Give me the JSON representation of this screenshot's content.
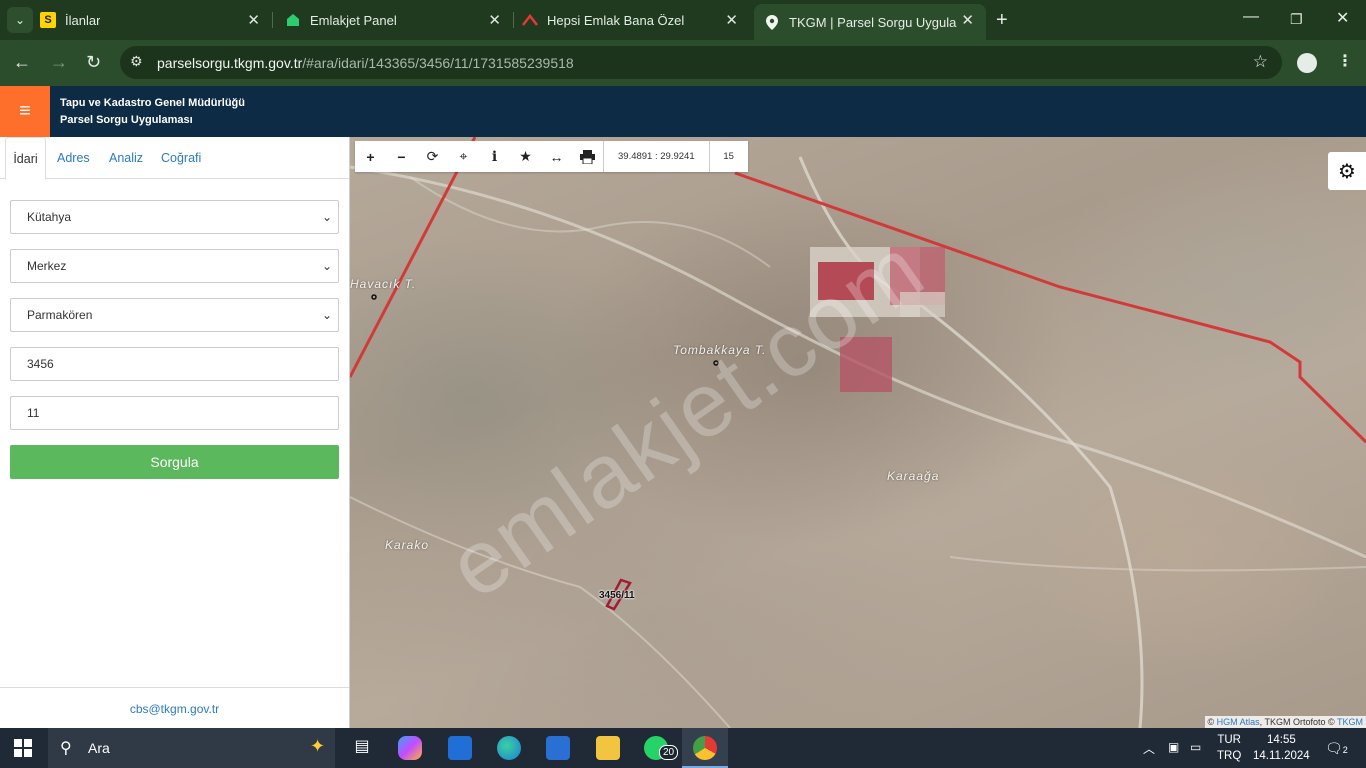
{
  "browser": {
    "tabs": [
      {
        "title": "İlanlar",
        "favicon": "S"
      },
      {
        "title": "Emlakjet Panel",
        "favicon": "house-icon"
      },
      {
        "title": "Hepsi Emlak Bana Özel",
        "favicon": "roof-icon"
      },
      {
        "title": "TKGM | Parsel Sorgu Uygulaması",
        "favicon": "pin-icon"
      }
    ],
    "url_host": "parselsorgu.tkgm.gov.tr",
    "url_path": "/#ara/idari/143365/3456/11/1731585239518"
  },
  "header": {
    "line1": "Tapu ve Kadastro Genel Müdürlüğü",
    "line2": "Parsel Sorgu Uygulaması",
    "accent": "#ff6f2c",
    "bg": "#0d2b45"
  },
  "sidebar": {
    "tabs": [
      "İdari",
      "Adres",
      "Analiz",
      "Coğrafi"
    ],
    "province": "Kütahya",
    "district": "Merkez",
    "neighborhood": "Parmakören",
    "block": "3456",
    "parcel": "11",
    "query_button": "Sorgula",
    "footer_email": "cbs@tkgm.gov.tr"
  },
  "map": {
    "coordinates": "39.4891 : 29.9241",
    "zoom": "15",
    "labels": [
      "Havacık T.",
      "Tombakkaya T.",
      "Karaağa",
      "Karako"
    ],
    "parcel_label": "3456/11",
    "watermark": "emlakjet.com",
    "attribution": {
      "prefix": "©",
      "hgm": "HGM Atlas",
      "middle": ", TKGM Ortofoto ©",
      "tkgm": "TKGM"
    }
  },
  "taskbar": {
    "search_placeholder": "Ara",
    "whatsapp_badge": "20",
    "lang_top": "TUR",
    "lang_bottom": "TRQ",
    "time": "14:55",
    "date": "14.11.2024",
    "notifications": "2"
  }
}
